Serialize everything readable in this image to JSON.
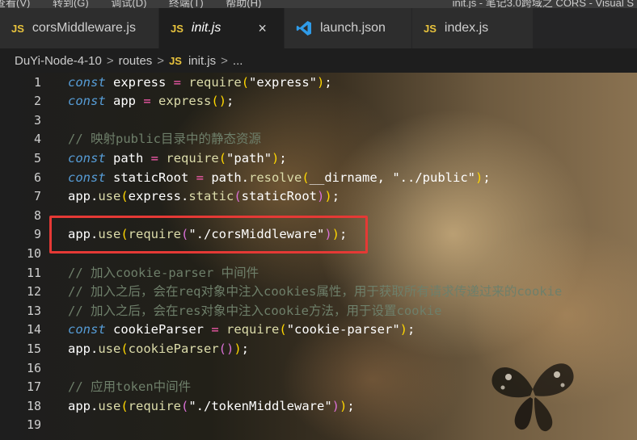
{
  "menubar": {
    "items": [
      "查看(V)",
      "转到(G)",
      "调试(D)",
      "终端(T)",
      "帮助(H)"
    ],
    "window_title": "init.js - 笔记3.0跨域之 CORS - Visual S"
  },
  "tabs": [
    {
      "label": "corsMiddleware.js",
      "icon": "js-icon",
      "icon_text": "JS"
    },
    {
      "label": "init.js",
      "icon": "js-icon",
      "icon_text": "JS",
      "active": true,
      "close": "×"
    },
    {
      "label": "launch.json",
      "icon": "vscode-icon"
    },
    {
      "label": "index.js",
      "icon": "js-icon",
      "icon_text": "JS"
    }
  ],
  "breadcrumb": {
    "folder1": "DuYi-Node-4-10",
    "folder2": "routes",
    "file_icon_text": "JS",
    "file": "init.js",
    "more": "...",
    "sep": ">"
  },
  "editor": {
    "line_numbers": [
      "1",
      "2",
      "3",
      "4",
      "5",
      "6",
      "7",
      "8",
      "9",
      "10",
      "11",
      "12",
      "13",
      "14",
      "15",
      "16",
      "17",
      "18",
      "19"
    ],
    "lines": [
      [
        [
          "kw",
          "const"
        ],
        [
          "",
          " express "
        ],
        [
          "op",
          "="
        ],
        [
          "",
          " "
        ],
        [
          "fn",
          "require"
        ],
        [
          "pn",
          "("
        ],
        [
          "str",
          "\"express\""
        ],
        [
          "pn",
          ")"
        ],
        [
          "",
          ";"
        ]
      ],
      [
        [
          "kw",
          "const"
        ],
        [
          "",
          " app "
        ],
        [
          "op",
          "="
        ],
        [
          "",
          " "
        ],
        [
          "fn",
          "express"
        ],
        [
          "pn",
          "()"
        ],
        [
          "",
          ";"
        ]
      ],
      [],
      [
        [
          "cm",
          "// 映射public目录中的静态资源"
        ]
      ],
      [
        [
          "kw",
          "const"
        ],
        [
          "",
          " path "
        ],
        [
          "op",
          "="
        ],
        [
          "",
          " "
        ],
        [
          "fn",
          "require"
        ],
        [
          "pn",
          "("
        ],
        [
          "str",
          "\"path\""
        ],
        [
          "pn",
          ")"
        ],
        [
          "",
          ";"
        ]
      ],
      [
        [
          "kw",
          "const"
        ],
        [
          "",
          " staticRoot "
        ],
        [
          "op",
          "="
        ],
        [
          "",
          " path."
        ],
        [
          "fn",
          "resolve"
        ],
        [
          "pn",
          "("
        ],
        [
          "",
          "__dirname, "
        ],
        [
          "str",
          "\"../public\""
        ],
        [
          "pn",
          ")"
        ],
        [
          "",
          ";"
        ]
      ],
      [
        [
          "",
          "app."
        ],
        [
          "fn",
          "use"
        ],
        [
          "pn",
          "("
        ],
        [
          "",
          "express."
        ],
        [
          "fn",
          "static"
        ],
        [
          "pn2",
          "("
        ],
        [
          "",
          "staticRoot"
        ],
        [
          "pn2",
          ")"
        ],
        [
          "pn",
          ")"
        ],
        [
          "",
          ";"
        ]
      ],
      [],
      [
        [
          "",
          "app."
        ],
        [
          "fn",
          "use"
        ],
        [
          "pn",
          "("
        ],
        [
          "fn",
          "require"
        ],
        [
          "pn2",
          "("
        ],
        [
          "str",
          "\"./corsMiddleware\""
        ],
        [
          "pn2",
          ")"
        ],
        [
          "pn",
          ")"
        ],
        [
          "",
          ";"
        ]
      ],
      [],
      [
        [
          "cm",
          "// 加入cookie-parser 中间件"
        ]
      ],
      [
        [
          "cm",
          "// 加入之后，会在req对象中注入cookies属性，用于获取所有请求传递过来的cookie"
        ]
      ],
      [
        [
          "cm",
          "// 加入之后，会在res对象中注入cookie方法，用于设置cookie"
        ]
      ],
      [
        [
          "kw",
          "const"
        ],
        [
          "",
          " cookieParser "
        ],
        [
          "op",
          "="
        ],
        [
          "",
          " "
        ],
        [
          "fn",
          "require"
        ],
        [
          "pn",
          "("
        ],
        [
          "str",
          "\"cookie-parser\""
        ],
        [
          "pn",
          ")"
        ],
        [
          "",
          ";"
        ]
      ],
      [
        [
          "",
          "app."
        ],
        [
          "fn",
          "use"
        ],
        [
          "pn",
          "("
        ],
        [
          "fn",
          "cookieParser"
        ],
        [
          "pn2",
          "()"
        ],
        [
          "pn",
          ")"
        ],
        [
          "",
          ";"
        ]
      ],
      [],
      [
        [
          "cm",
          "// 应用token中间件"
        ]
      ],
      [
        [
          "",
          "app."
        ],
        [
          "fn",
          "use"
        ],
        [
          "pn",
          "("
        ],
        [
          "fn",
          "require"
        ],
        [
          "pn2",
          "("
        ],
        [
          "str",
          "\"./tokenMiddleware\""
        ],
        [
          "pn2",
          ")"
        ],
        [
          "pn",
          ")"
        ],
        [
          "",
          ";"
        ]
      ],
      []
    ]
  },
  "colors": {
    "keyword": "#569cd6",
    "function": "#dcdcaa",
    "operator": "#ff5db3",
    "comment": "#6e7f6a",
    "bracket1": "#ffd700",
    "bracket2": "#da70d6",
    "highlight_box": "#e53935",
    "js_icon": "#e8c33d"
  }
}
